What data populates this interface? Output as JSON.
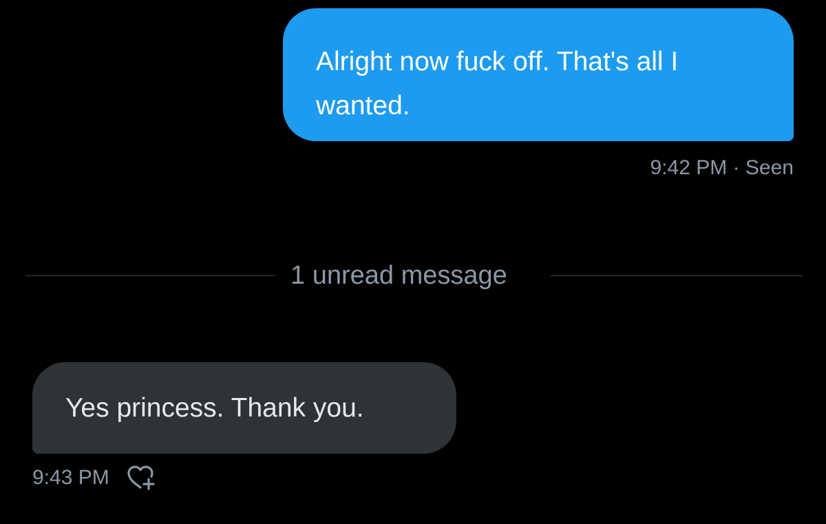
{
  "messages": {
    "sent": {
      "text": "Alright now fuck off. That's all I wanted.",
      "time": "9:42 PM",
      "separator": "·",
      "status": "Seen"
    },
    "divider": {
      "label": "1 unread message"
    },
    "received": {
      "text": "Yes princess. Thank you.",
      "time": "9:43 PM",
      "reaction_icon": "heart-plus-icon"
    }
  },
  "colors": {
    "background": "#000000",
    "sent_bubble": "#1d9bf0",
    "received_bubble": "#2f3336",
    "meta_text": "#8b98a5",
    "received_text": "#e7e9ea",
    "divider_line": "#3e4144"
  }
}
